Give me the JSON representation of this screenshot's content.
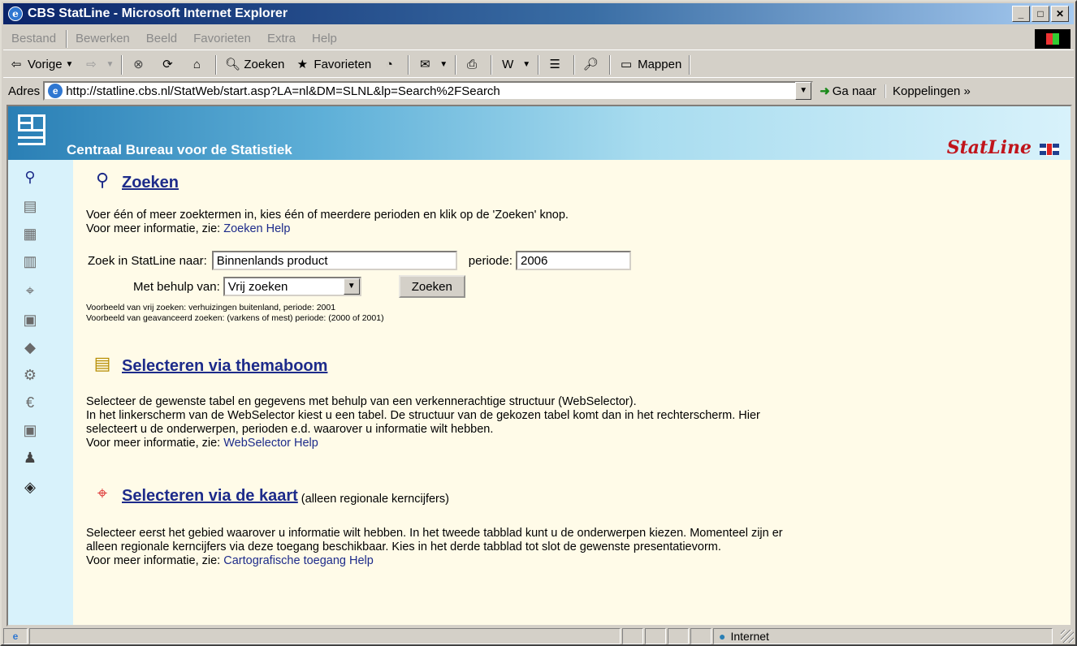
{
  "window": {
    "title": "CBS StatLine - Microsoft Internet Explorer",
    "controls": {
      "minimize": "_",
      "maximize": "□",
      "close": "✕"
    }
  },
  "menu": [
    "Bestand",
    "Bewerken",
    "Beeld",
    "Favorieten",
    "Extra",
    "Help"
  ],
  "toolbar": {
    "back": "Vorige",
    "search": "Zoeken",
    "favorites": "Favorieten",
    "folders": "Mappen"
  },
  "address": {
    "label": "Adres",
    "url": "http://statline.cbs.nl/StatWeb/start.asp?LA=nl&DM=SLNL&lp=Search%2FSearch",
    "go": "Ga naar",
    "links": "Koppelingen"
  },
  "banner": {
    "org": "Centraal Bureau voor de Statistiek",
    "brand": "StatLine"
  },
  "zoeken": {
    "title": "Zoeken",
    "intro": "Voer één of meer zoektermen in, kies één of meerdere perioden en klik op de 'Zoeken' knop.",
    "more_prefix": "Voor meer informatie, zie:",
    "help_link": "Zoeken Help",
    "search_label": "Zoek in StatLine naar:",
    "search_value": "Binnenlands product",
    "period_label": "periode:",
    "period_value": "2006",
    "method_label": "Met behulp van:",
    "method_value": "Vrij zoeken",
    "button": "Zoeken",
    "example1": "Voorbeeld van vrij zoeken: verhuizingen buitenland, periode: 2001",
    "example2": "Voorbeeld van geavanceerd zoeken: (varkens of mest) periode: (2000 of 2001)"
  },
  "themaboom": {
    "title": "Selecteren via themaboom",
    "line1": "Selecteer de gewenste tabel en gegevens met behulp van een verkennerachtige structuur (WebSelector).",
    "line2": "In het linkerscherm van de WebSelector kiest u een tabel. De structuur van de gekozen tabel komt dan in het rechterscherm. Hier",
    "line3": "selecteert u de onderwerpen, perioden e.d. waarover u informatie wilt hebben.",
    "more_prefix": "Voor meer informatie, zie:",
    "help_link": "WebSelector Help"
  },
  "kaart": {
    "title": "Selecteren via de kaart",
    "note": "(alleen regionale kerncijfers)",
    "line1": "Selecteer eerst het gebied waarover u informatie wilt hebben. In het tweede tabblad kunt u de onderwerpen kiezen. Momenteel zijn er",
    "line2": "alleen regionale kerncijfers via deze toegang beschikbaar. Kies in het derde tabblad tot slot de gewenste presentatievorm.",
    "more_prefix": "Voor meer informatie, zie:",
    "help_link": "Cartografische toegang Help"
  },
  "status": {
    "zone": "Internet"
  }
}
